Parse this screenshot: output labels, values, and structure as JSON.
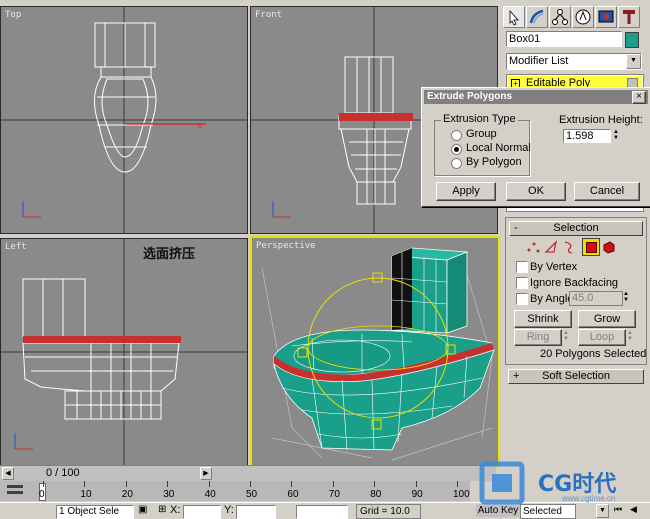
{
  "viewports": {
    "top": {
      "label": "Top"
    },
    "front": {
      "label": "Front"
    },
    "left": {
      "label": "Left"
    },
    "perspective": {
      "label": "Perspective"
    }
  },
  "annotation": "选面挤压",
  "command_panel": {
    "tabs": [
      "create-icon",
      "modify-icon",
      "hierarchy-icon",
      "motion-icon",
      "display-icon",
      "utilities-icon"
    ],
    "object_name": "Box01",
    "object_color": "#1aa08a",
    "modifier_list": "Modifier List",
    "stack_item": "Editable Poly"
  },
  "dialog": {
    "title": "Extrude Polygons",
    "group_label": "Extrusion Type",
    "options": [
      "Group",
      "Local Normal",
      "By Polygon"
    ],
    "selected": "Local Normal",
    "height_label": "Extrusion Height:",
    "height_value": "1.598",
    "apply": "Apply",
    "ok": "OK",
    "cancel": "Cancel",
    "close": "×"
  },
  "selection_rollout": {
    "title": "Selection",
    "sign": "-",
    "by_vertex": "By Vertex",
    "ignore_backfacing": "Ignore Backfacing",
    "by_angle": "By Angle:",
    "angle_value": "45.0",
    "shrink": "Shrink",
    "grow": "Grow",
    "ring": "Ring",
    "loop": "Loop",
    "status": "20 Polygons Selected"
  },
  "soft_selection": {
    "title": "Soft Selection",
    "sign": "+"
  },
  "timeline": {
    "frame": "0 / 100",
    "ticks": [
      "0",
      "10",
      "20",
      "30",
      "40",
      "50",
      "60",
      "70",
      "80",
      "90",
      "100"
    ]
  },
  "status_bar": {
    "selection": "1 Object Sele",
    "x_label": "X:",
    "y_label": "Y:",
    "grid": "Grid = 10.0",
    "autokey": "Auto Key",
    "selected": "Selected"
  },
  "watermark": {
    "brand": "CG时代",
    "url": "www.cgtime.cn"
  },
  "colors": {
    "viewport_bg": "#8a8a8a",
    "wire": "#ffffff",
    "selected_red": "#c83030",
    "mesh_teal": "#1aa08a",
    "active_border": "#e8e000"
  }
}
